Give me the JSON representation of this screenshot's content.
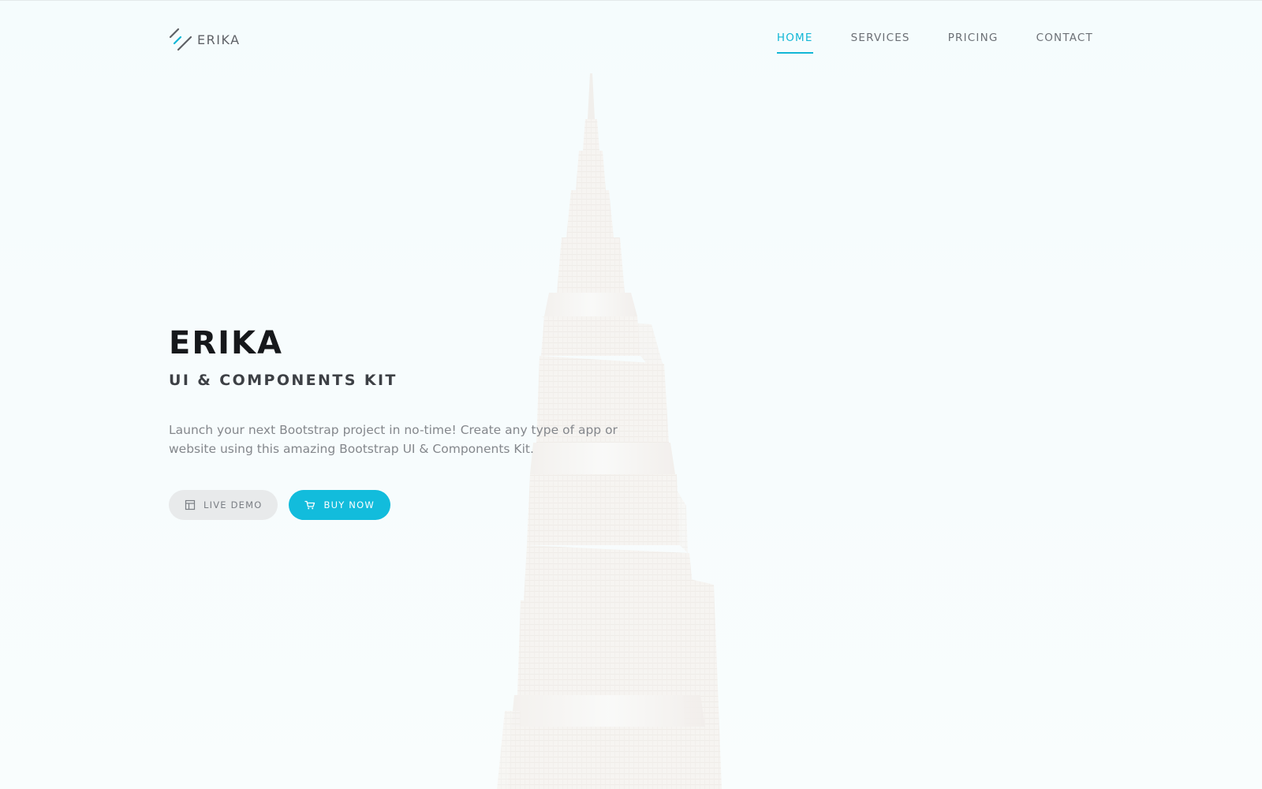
{
  "brand": {
    "name": "ERIKA",
    "logo_icon": "slashes-logo-icon"
  },
  "nav": {
    "items": [
      {
        "label": "HOME",
        "active": true
      },
      {
        "label": "SERVICES",
        "active": false
      },
      {
        "label": "PRICING",
        "active": false
      },
      {
        "label": "CONTACT",
        "active": false
      }
    ]
  },
  "hero": {
    "title": "ERIKA",
    "subtitle": "UI & COMPONENTS KIT",
    "description": "Launch your next Bootstrap project in no-time! Create any type of app or website using this amazing Bootstrap UI & Components Kit.",
    "buttons": {
      "demo": {
        "label": "LIVE DEMO",
        "icon": "layout-icon"
      },
      "buy": {
        "label": "BUY NOW",
        "icon": "cart-icon"
      }
    }
  },
  "background": {
    "image": "skyscraper-tower-photo"
  },
  "colors": {
    "accent": "#12b7d6",
    "title": "#16181b",
    "text_muted": "#84878c",
    "background": "#f5fcfd"
  }
}
